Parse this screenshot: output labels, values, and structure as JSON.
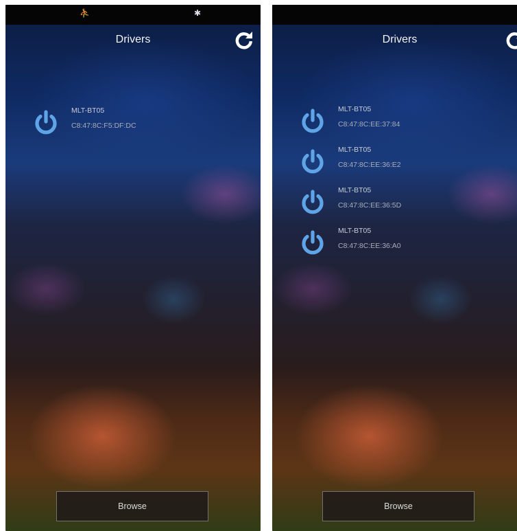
{
  "colors": {
    "accent": "#5ea4e6",
    "title_text": "#f3f4f6",
    "statusbar": "#050506"
  },
  "icons": {
    "refresh": "refresh-icon",
    "power": "power-icon",
    "status_left": "app-notification-icon",
    "status_bluetooth": "bluetooth-icon"
  },
  "screens": [
    {
      "statusbar": {
        "left_glyph": "⛹",
        "bluetooth_glyph": "✱"
      },
      "title": "Drivers",
      "devices": [
        {
          "name": "MLT-BT05",
          "mac": "C8:47:8C:F5:DF:DC"
        }
      ],
      "browse_label": "Browse"
    },
    {
      "statusbar": {},
      "title": "Drivers",
      "devices": [
        {
          "name": "MLT-BT05",
          "mac": "C8:47:8C:EE:37:84"
        },
        {
          "name": "MLT-BT05",
          "mac": "C8:47:8C:EE:36:E2"
        },
        {
          "name": "MLT-BT05",
          "mac": "C8:47:8C:EE:36:5D"
        },
        {
          "name": "MLT-BT05",
          "mac": "C8:47:8C:EE:36:A0"
        }
      ],
      "browse_label": "Browse"
    }
  ]
}
